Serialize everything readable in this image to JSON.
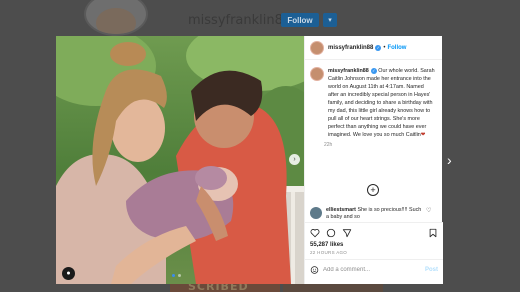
{
  "background": {
    "username": "missyfranklin88",
    "follow_label": "Follow",
    "chevron": "▾",
    "thumb_text": "SCRIBED"
  },
  "post": {
    "username": "missyfranklin88",
    "separator": "•",
    "follow_label": "Follow",
    "verified_glyph": "✓",
    "caption_prefix": "missyfranklin88",
    "caption": "Our whole world. Sarah Caitlin Johnson made her entrance into the world on August 11th at 4:17am. Named after an incredibly special person in Hayes' family, and deciding to share a birthday with my dad, this little girl already knows how to pull all of our heart strings. She's more perfect than anything we could have ever imagined. We love you so much Caitlin",
    "caption_emoji": "❤",
    "caption_time": "22h",
    "load_more": "+",
    "comment": {
      "username": "elliestsmart",
      "text": "She is so precious!!!! Such a baby and so",
      "heart": "♡"
    },
    "likes": "55,287 likes",
    "post_time": "22 HOURS AGO",
    "add_comment_placeholder": "Add a comment...",
    "post_label": "Post",
    "tag_glyph": "●",
    "next_glyph": "›"
  },
  "nav": {
    "next_glyph": "›"
  },
  "colors": {
    "accent": "#0095f6",
    "verified": "#3897f0"
  }
}
